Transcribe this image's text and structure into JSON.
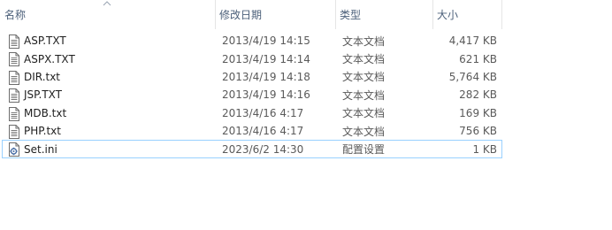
{
  "columns": {
    "name": "名称",
    "date_modified": "修改日期",
    "type": "类型",
    "size": "大小"
  },
  "files": [
    {
      "name": "ASP.TXT",
      "date": "2013/4/19 14:15",
      "type": "文本文档",
      "size": "4,417 KB",
      "icon": "text-file-icon"
    },
    {
      "name": "ASPX.TXT",
      "date": "2013/4/19 14:14",
      "type": "文本文档",
      "size": "621 KB",
      "icon": "text-file-icon"
    },
    {
      "name": "DIR.txt",
      "date": "2013/4/19 14:18",
      "type": "文本文档",
      "size": "5,764 KB",
      "icon": "text-file-icon"
    },
    {
      "name": "JSP.TXT",
      "date": "2013/4/19 14:16",
      "type": "文本文档",
      "size": "282 KB",
      "icon": "text-file-icon"
    },
    {
      "name": "MDB.txt",
      "date": "2013/4/16 4:17",
      "type": "文本文档",
      "size": "169 KB",
      "icon": "text-file-icon"
    },
    {
      "name": "PHP.txt",
      "date": "2013/4/16 4:17",
      "type": "文本文档",
      "size": "756 KB",
      "icon": "text-file-icon"
    },
    {
      "name": "Set.ini",
      "date": "2023/6/2 14:30",
      "type": "配置设置",
      "size": "1 KB",
      "icon": "config-file-icon",
      "selected": true
    }
  ],
  "colors": {
    "header_text": "#4c607a",
    "selection_border": "#99d1ff"
  }
}
